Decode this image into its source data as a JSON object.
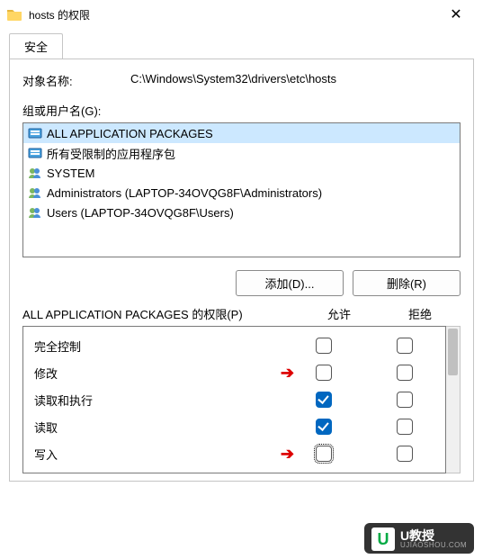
{
  "window": {
    "title": "hosts 的权限",
    "close_glyph": "✕"
  },
  "tab": {
    "security": "安全"
  },
  "object": {
    "label": "对象名称:",
    "path": "C:\\Windows\\System32\\drivers\\etc\\hosts"
  },
  "groups": {
    "label": "组或用户名(G):",
    "items": [
      {
        "icon": "group",
        "name": "ALL APPLICATION PACKAGES"
      },
      {
        "icon": "group",
        "name": "所有受限制的应用程序包"
      },
      {
        "icon": "users",
        "name": "SYSTEM"
      },
      {
        "icon": "users",
        "name": "Administrators (LAPTOP-34OVQG8F\\Administrators)"
      },
      {
        "icon": "users",
        "name": "Users (LAPTOP-34OVQG8F\\Users)"
      }
    ],
    "selected_index": 0
  },
  "buttons": {
    "add": "添加(D)...",
    "remove": "删除(R)"
  },
  "perm_header": {
    "name_prefix": "ALL APPLICATION PACKAGES 的权限(P)",
    "allow": "允许",
    "deny": "拒绝"
  },
  "permissions": [
    {
      "label": "完全控制",
      "allow": false,
      "deny": false,
      "arrow": false,
      "focus": false
    },
    {
      "label": "修改",
      "allow": false,
      "deny": false,
      "arrow": true,
      "focus": false
    },
    {
      "label": "读取和执行",
      "allow": true,
      "deny": false,
      "arrow": false,
      "focus": false
    },
    {
      "label": "读取",
      "allow": true,
      "deny": false,
      "arrow": false,
      "focus": false
    },
    {
      "label": "写入",
      "allow": false,
      "deny": false,
      "arrow": true,
      "focus": true
    }
  ],
  "watermark": {
    "u": "U",
    "cn": "U教授",
    "en": "UJIAOSHOU.COM"
  }
}
